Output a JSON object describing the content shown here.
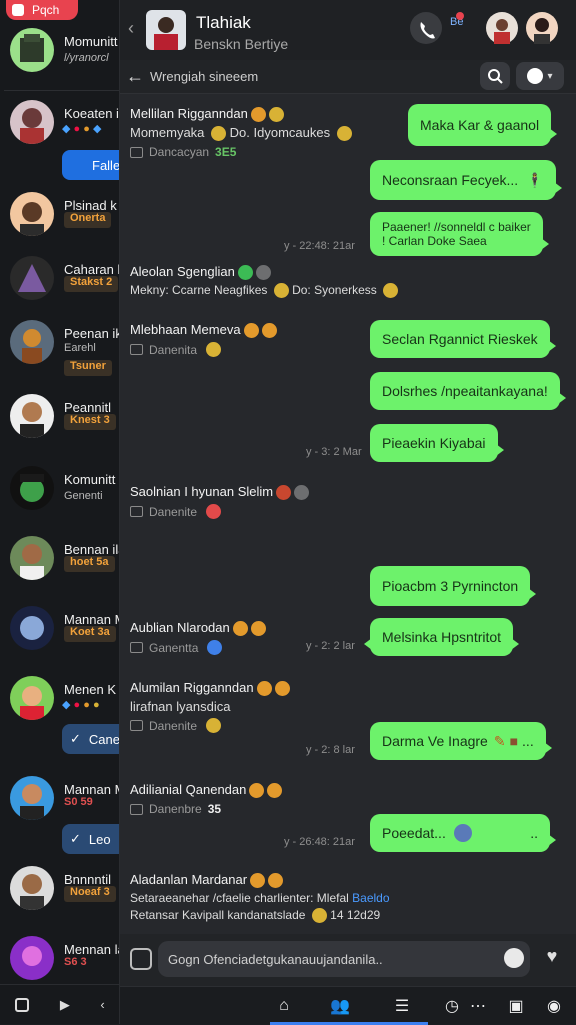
{
  "sidebar": {
    "top_tab_label": "Pqch",
    "items": [
      {
        "name": "Momunitt",
        "sub": "l/yranorcl",
        "tag": ""
      },
      {
        "name": "Koeaten ik",
        "sub": "",
        "tag": ""
      },
      {
        "name": "Plsinad k",
        "sub": "",
        "tag": "Onerta"
      },
      {
        "name": "Caharan k",
        "sub": "",
        "tag": "Stakst 2"
      },
      {
        "name": "Peenan ik",
        "sub": "Earehl",
        "tag": "Tsuner"
      },
      {
        "name": "Peannitl",
        "sub": "",
        "tag": "Knest 3"
      },
      {
        "name": "Komunitt",
        "sub": "Genenti",
        "tag": ""
      },
      {
        "name": "Bennan ila",
        "sub": "",
        "tag": "hoet 5a"
      },
      {
        "name": "Mannan M",
        "sub": "",
        "tag": "Koet 3a"
      },
      {
        "name": "Menen K",
        "sub": "",
        "tag": ""
      },
      {
        "name": "Mannan M",
        "sub": "",
        "tag": "S0 59"
      },
      {
        "name": "Bnnnntil",
        "sub": "",
        "tag": "Noeaf 3"
      },
      {
        "name": "Mennan la",
        "sub": "",
        "tag": "S6 3"
      }
    ],
    "btn_fallo": "Falle",
    "btn_cane": "Cane",
    "btn_leo": "Leo"
  },
  "header": {
    "title": "Tlahiak",
    "subtitle": "Benskn Bertiye",
    "badge_label": "Be"
  },
  "subheader": {
    "text": "Wrengiah sineeem"
  },
  "messages_in": [
    {
      "sender": "Mellilan Rigganndan",
      "line2": "Momemyaka",
      "line2b": "Do. Idyomcaukes",
      "meta": "Dancacyan",
      "num": "3E5"
    },
    {
      "sender": "Aleolan Sgenglian",
      "line2": "Mekny: Ccarne Neagfikes",
      "line2b": "Do: Syonerkess",
      "meta": "",
      "num": ""
    },
    {
      "sender": "Mlebhaan Memeva",
      "line2": "",
      "line2b": "",
      "meta": "Danenita",
      "num": ""
    },
    {
      "sender": "Saolnian I hyunan Slelim",
      "line2": "",
      "line2b": "",
      "meta": "Danenite",
      "num": ""
    },
    {
      "sender": "Aublian Nlarodan",
      "line2": "",
      "line2b": "",
      "meta": "Ganentta",
      "num": ""
    },
    {
      "sender": "Alumilan Rigganndan",
      "line2": "lirafnan lyansdica",
      "line2b": "",
      "meta": "Danenite",
      "num": ""
    },
    {
      "sender": "Adilianial Qanendan",
      "line2": "",
      "line2b": "",
      "meta": "Danenbre",
      "num": "35"
    },
    {
      "sender": "Aladanlan Mardanar",
      "line2": "Setaraeanehar /cfaelie charlienter: Mlefal",
      "line2link": "Baeldo",
      "line3": "Retansar Kavipall kandanatslade",
      "line3b": "14 12d29"
    }
  ],
  "messages_out": [
    {
      "text": "Maka Kar & gaanol"
    },
    {
      "text": "Neconsraan Fecyek..."
    },
    {
      "text": "Paaener! //sonneldl c baiker",
      "text2": "! Carlan Doke Saea"
    },
    {
      "text": "Seclan Rgannict Rieskek"
    },
    {
      "text": "Dolsrhes /npeaitankayana!"
    },
    {
      "text": "Pieaekin Kiyabai"
    },
    {
      "text": "Pioacbm 3 Pyrnincton"
    },
    {
      "text": "Melsinka Hpsntritot"
    },
    {
      "text": "Darma Ve Inagre"
    },
    {
      "text": "Poeedat..."
    }
  ],
  "timestamps": [
    "y - 22:48: 21ar",
    "y - 3: 2 Mar",
    "y - 2: 2 lar",
    "y - 2: 8 lar",
    "y - 26:48: 21ar"
  ],
  "composer": {
    "placeholder": "Gogn Ofenciadetgukanauujandanila.."
  },
  "colors": {
    "accent": "#3b7ff0",
    "bubble": "#6df26b",
    "badge": "#e8434f"
  }
}
